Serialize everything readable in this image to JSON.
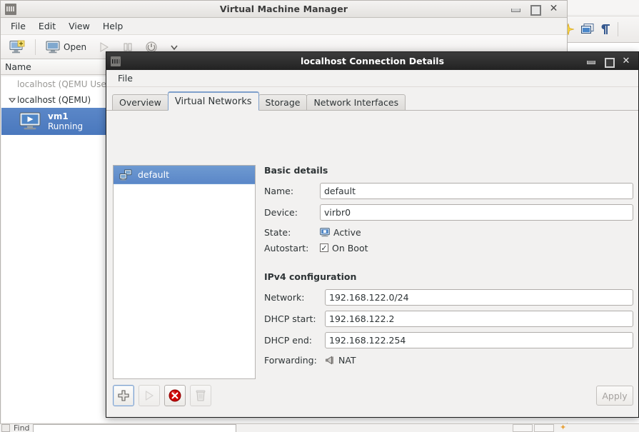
{
  "background_app": {
    "icons": [
      "star-icon",
      "windows-switch-icon",
      "pilcrow-icon"
    ]
  },
  "main_window": {
    "title": "Virtual Machine Manager",
    "title_icon": "vmm-app-icon",
    "window_buttons": {
      "minimize": "–",
      "maximize": "□",
      "close": "✕"
    },
    "menu": [
      "File",
      "Edit",
      "View",
      "Help"
    ],
    "toolbar": {
      "new_vm_label": "new-vm-icon",
      "open_label": "Open",
      "run_label": "run-icon",
      "pause_label": "pause-icon",
      "shutdown_label": "shutdown-icon",
      "dropdown_label": "chevron-down-icon"
    },
    "list_header": "Name",
    "rows": [
      {
        "label": "localhost (QEMU User",
        "type": "dim"
      },
      {
        "label": "localhost (QEMU)",
        "type": "parent"
      }
    ],
    "vm": {
      "name": "vm1",
      "state": "Running",
      "icon": "vm-running-icon"
    }
  },
  "find_bar": {
    "label": "Find",
    "input_value": ""
  },
  "dialog": {
    "title": "localhost Connection Details",
    "title_icon": "vmm-app-icon",
    "window_buttons": {
      "minimize": "–",
      "maximize": "□",
      "close": "✕"
    },
    "menu": [
      "File"
    ],
    "tabs": [
      {
        "label": "Overview",
        "active": false
      },
      {
        "label": "Virtual Networks",
        "active": true
      },
      {
        "label": "Storage",
        "active": false
      },
      {
        "label": "Network Interfaces",
        "active": false
      }
    ],
    "network_list": [
      {
        "name": "default",
        "icon": "network-icon",
        "selected": true
      }
    ],
    "basic_details": {
      "heading": "Basic details",
      "name_label": "Name:",
      "name_value": "default",
      "device_label": "Device:",
      "device_value": "virbr0",
      "state_label": "State:",
      "state_value": "Active",
      "state_icon": "active-network-icon",
      "autostart_label": "Autostart:",
      "autostart_value": "On Boot",
      "autostart_checked": "✓"
    },
    "ipv4": {
      "heading": "IPv4 configuration",
      "network_label": "Network:",
      "network_value": "192.168.122.0/24",
      "dhcp_start_label": "DHCP start:",
      "dhcp_start_value": "192.168.122.2",
      "dhcp_end_label": "DHCP end:",
      "dhcp_end_value": "192.168.122.254",
      "forwarding_label": "Forwarding:",
      "forwarding_value": "NAT",
      "forwarding_icon": "forward-nat-icon"
    },
    "footer": {
      "add_button": "add-network-icon",
      "start_button": "start-network-icon",
      "stop_button": "stop-network-icon",
      "delete_button": "delete-network-icon",
      "apply_label": "Apply"
    }
  },
  "colors": {
    "selection_blue": "#4a78bd",
    "tab_active_border": "#7fa0cb",
    "window_bg": "#f2f1f0",
    "dialog_titlebar": "#222222",
    "stop_red": "#cc0000"
  }
}
